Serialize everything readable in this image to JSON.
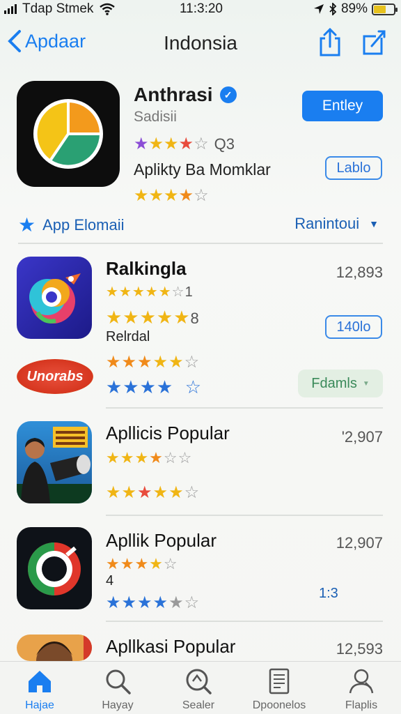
{
  "status": {
    "carrier": "Tdap Stmek",
    "time": "11:3:20",
    "battery": "89%",
    "battery_level": 0.6
  },
  "nav": {
    "back_label": "Apdaar",
    "title": "Indonsia"
  },
  "featured": {
    "name": "Anthrasi",
    "subtitle": "Sadisii",
    "rating_count": "Q3",
    "description": "Aplikty Ba Momklar",
    "primary_button": "Entley",
    "secondary_button": "Lablo"
  },
  "section": {
    "left_label": "App Elomaii",
    "right_label": "Ranintoui"
  },
  "apps": [
    {
      "name": "Ralkingla",
      "count": "12,893",
      "star_note": "1",
      "star_note2": "8",
      "label": "Relrdal",
      "button": "140lo",
      "badge": "Unorabs",
      "pill": "Fdamls"
    },
    {
      "name": "Apllicis Popular",
      "count": "'2,907"
    },
    {
      "name": "Apllik Popular",
      "count": "12,907",
      "note": "4",
      "side": "1:3"
    },
    {
      "name": "Apllkasi Popular",
      "count": "12,593"
    }
  ],
  "tabs": [
    {
      "label": "Hajae",
      "icon": "home-icon"
    },
    {
      "label": "Hayay",
      "icon": "search-icon"
    },
    {
      "label": "Sealer",
      "icon": "explore-icon"
    },
    {
      "label": "Dpoonelos",
      "icon": "document-icon"
    },
    {
      "label": "Flaplis",
      "icon": "profile-icon"
    }
  ],
  "colors": {
    "accent": "#1a7ef0",
    "star_gold": "#f0b514",
    "pill_green": "#3a8a5a"
  }
}
